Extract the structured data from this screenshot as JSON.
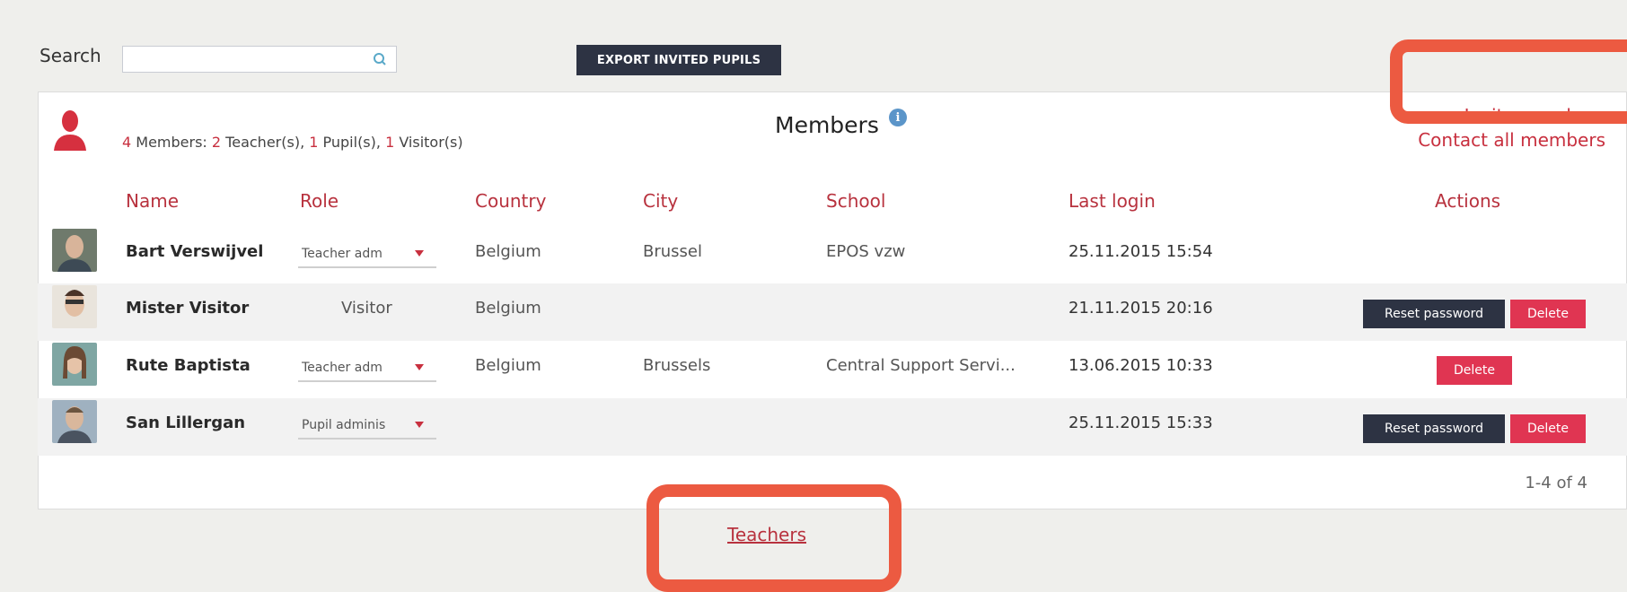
{
  "toolbar": {
    "search_label": "Search",
    "search_value": "",
    "export_label": "EXPORT INVITED PUPILS"
  },
  "panel": {
    "summary_count": "4",
    "summary_text_1": " Members: ",
    "summary_teachers": "2",
    "summary_text_2": " Teacher(s), ",
    "summary_pupils": "1",
    "summary_text_3": " Pupil(s), ",
    "summary_visitors": "1",
    "summary_text_4": " Visitor(s)",
    "title": "Members",
    "info_glyph": "i",
    "invite_label": "Invite members",
    "contact_label": "Contact all members"
  },
  "table": {
    "headers": {
      "name": "Name",
      "role": "Role",
      "country": "Country",
      "city": "City",
      "school": "School",
      "last_login": "Last login",
      "actions": "Actions"
    },
    "rows": [
      {
        "name": "Bart Verswijvel",
        "role": "Teacher adm",
        "country": "Belgium",
        "city": "Brussel",
        "school": "EPOS vzw",
        "last_login": "25.11.2015 15:54"
      },
      {
        "name": "Mister Visitor",
        "role": "Visitor",
        "country": "Belgium",
        "city": "",
        "school": "",
        "last_login": "21.11.2015 20:16",
        "reset": "Reset password",
        "delete": "Delete"
      },
      {
        "name": "Rute Baptista",
        "role": "Teacher adm",
        "country": "Belgium",
        "city": "Brussels",
        "school": "Central Support Servi...",
        "last_login": "13.06.2015 10:33",
        "delete": "Delete"
      },
      {
        "name": "San Lillergan",
        "role": "Pupil adminis",
        "country": "",
        "city": "",
        "school": "",
        "last_login": "25.11.2015 15:33",
        "reset": "Reset password",
        "delete": "Delete"
      }
    ]
  },
  "pagination": "1-4 of 4",
  "footer": {
    "teachers_link": "Teachers"
  },
  "colors": {
    "accent": "#c8303f",
    "dark_button": "#2d3343",
    "delete_button": "#e03552",
    "highlight": "#ec5a41"
  }
}
